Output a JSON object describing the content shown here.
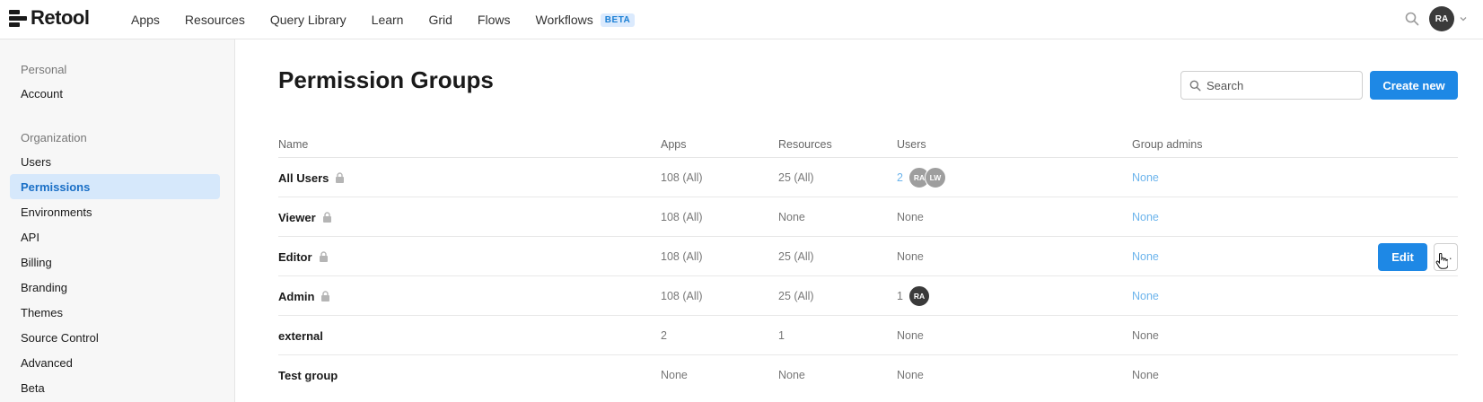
{
  "topbar": {
    "logo_text": "Retool",
    "nav": [
      "Apps",
      "Resources",
      "Query Library",
      "Learn",
      "Grid",
      "Flows",
      "Workflows"
    ],
    "workflows_badge": "BETA",
    "user_initials": "RA"
  },
  "sidebar": {
    "personal_label": "Personal",
    "personal_items": [
      "Account"
    ],
    "organization_label": "Organization",
    "organization_items": [
      "Users",
      "Permissions",
      "Environments",
      "API",
      "Billing",
      "Branding",
      "Themes",
      "Source Control",
      "Advanced",
      "Beta"
    ],
    "active_item": "Permissions"
  },
  "main": {
    "title": "Permission Groups",
    "search_placeholder": "Search",
    "create_label": "Create new",
    "columns": [
      "Name",
      "Apps",
      "Resources",
      "Users",
      "Group admins"
    ],
    "rows": [
      {
        "name": "All Users",
        "locked": true,
        "apps": "108 (All)",
        "resources": "25 (All)",
        "users_count": "2",
        "user_avatars": [
          "RA",
          "LW"
        ],
        "admins": "None"
      },
      {
        "name": "Viewer",
        "locked": true,
        "apps": "108 (All)",
        "resources": "None",
        "users_text": "None",
        "admins": "None"
      },
      {
        "name": "Editor",
        "locked": true,
        "apps": "108 (All)",
        "resources": "25 (All)",
        "users_text": "None",
        "admins": "None"
      },
      {
        "name": "Admin",
        "locked": true,
        "apps": "108 (All)",
        "resources": "25 (All)",
        "users_count": "1",
        "user_avatars": [
          "RA"
        ],
        "admins": "None"
      },
      {
        "name": "external",
        "locked": false,
        "apps": "2",
        "resources": "1",
        "users_text": "None",
        "admins": "None"
      },
      {
        "name": "Test group",
        "locked": false,
        "apps": "None",
        "resources": "None",
        "users_text": "None",
        "admins": "None"
      }
    ],
    "edit_label": "Edit",
    "more_label": "···"
  },
  "colors": {
    "primary": "#1e88e5",
    "active_bg": "#d6e8fb",
    "link": "#6cb4ec"
  }
}
